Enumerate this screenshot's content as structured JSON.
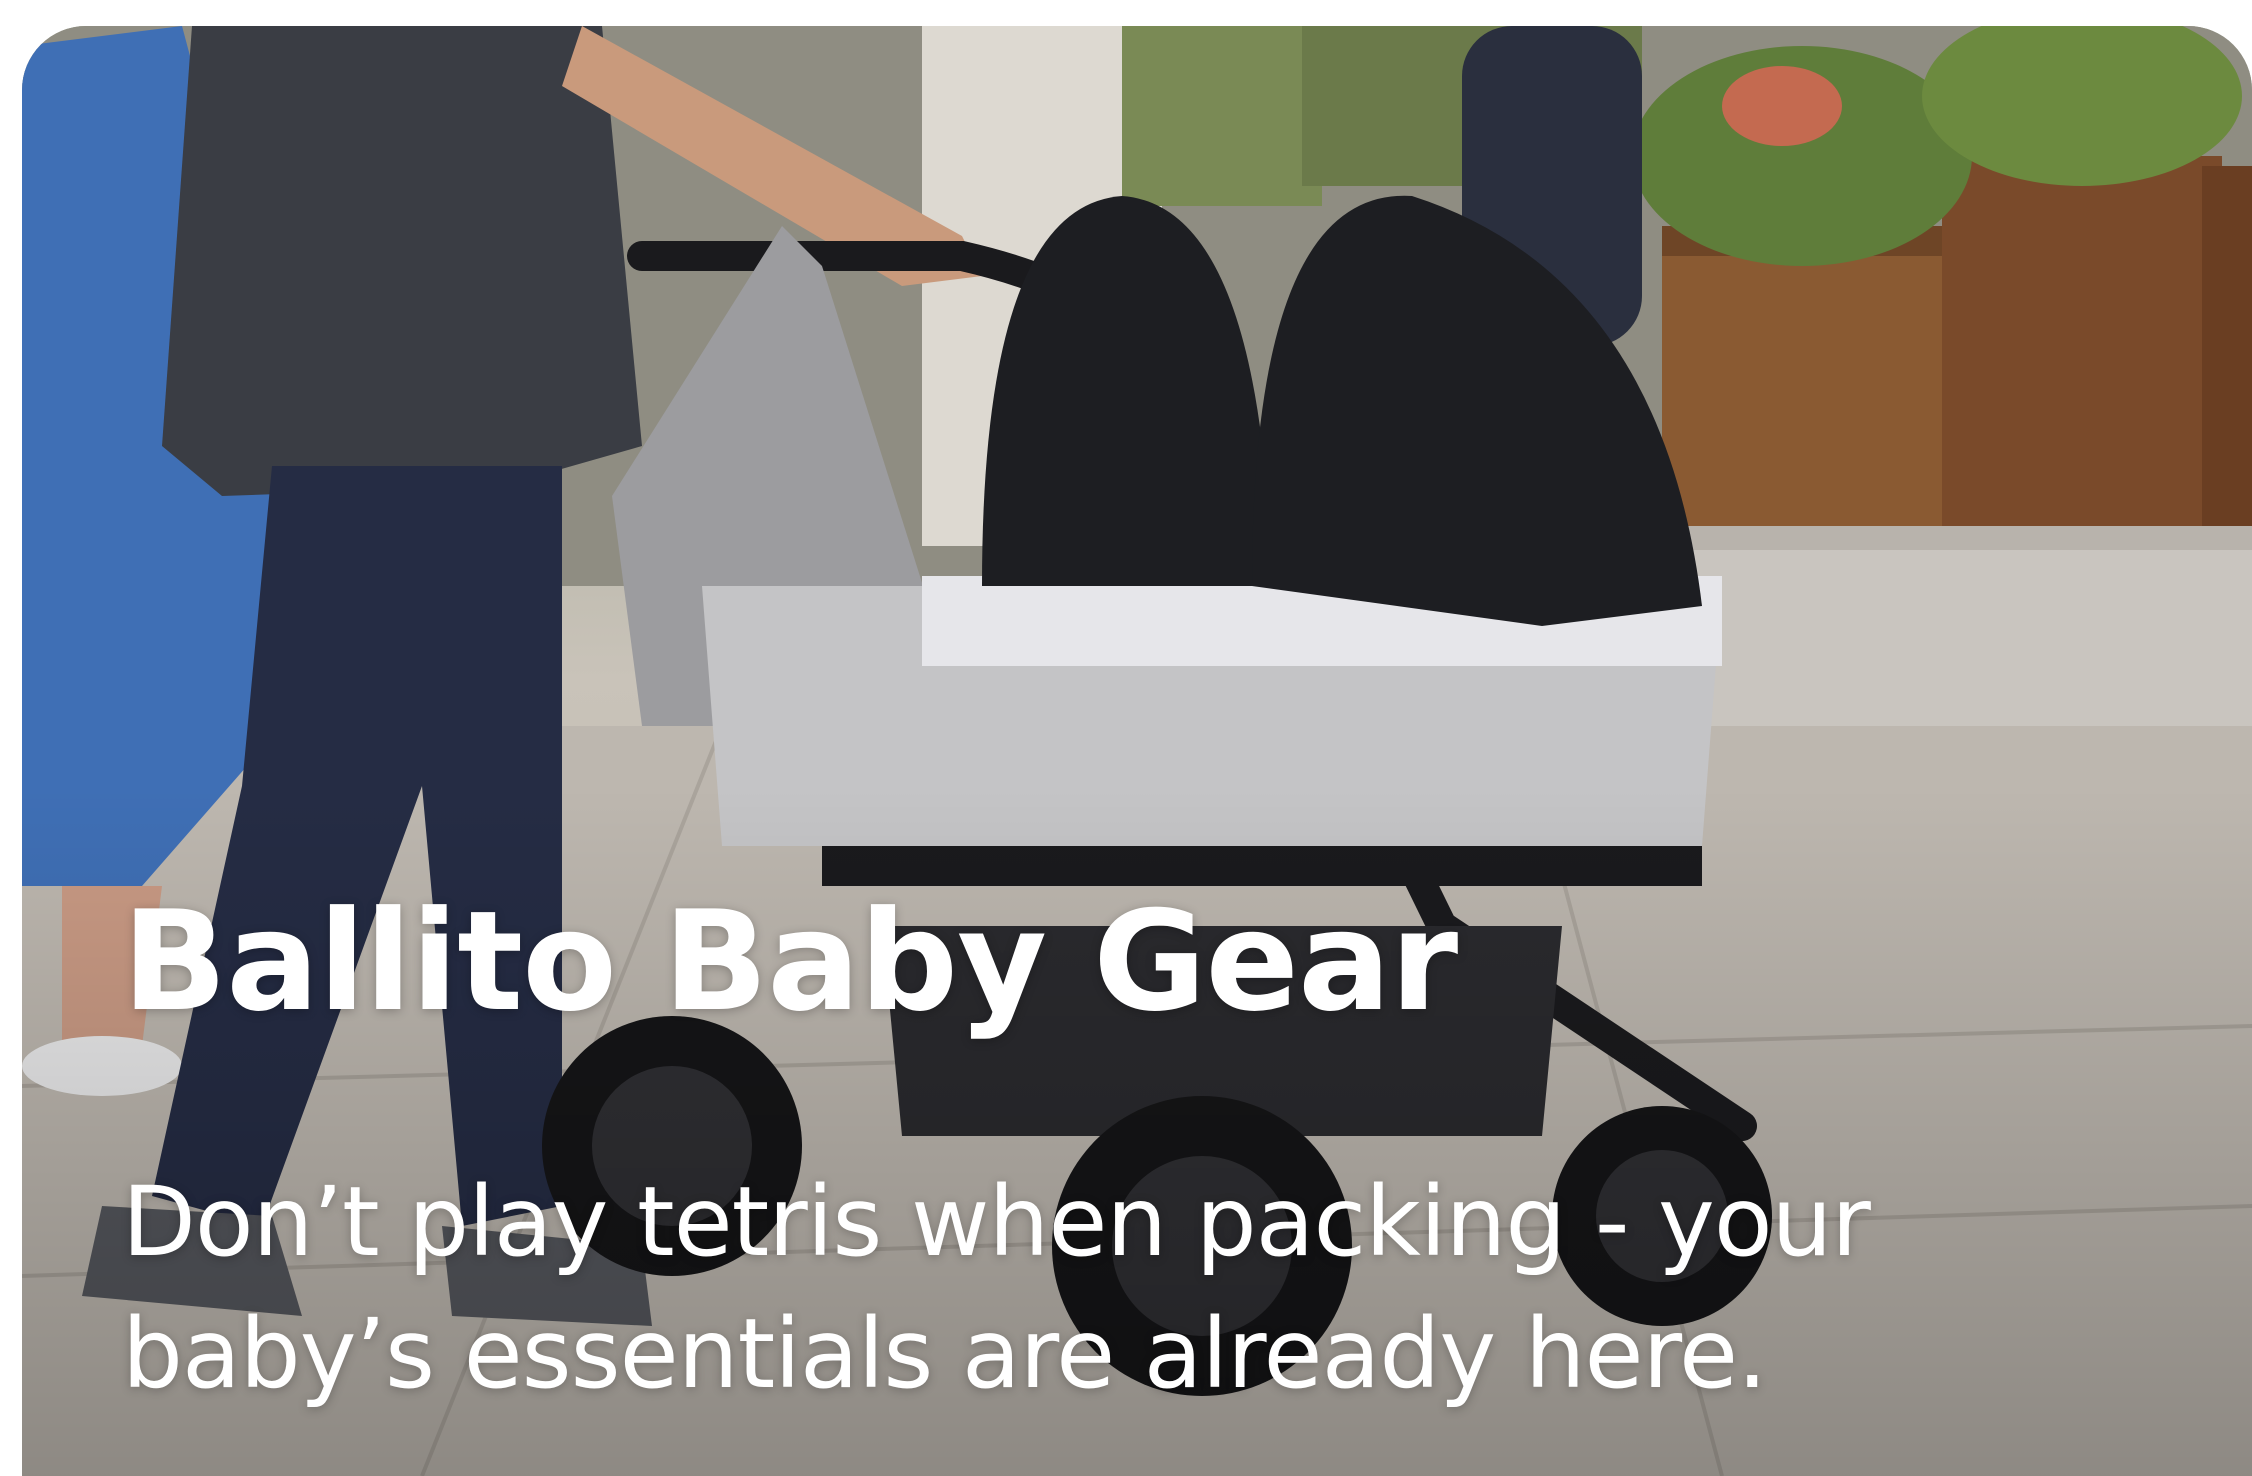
{
  "card": {
    "title": "Ballito Baby Gear",
    "description": "Don’t play tetris when packing - your baby’s essentials are already here.",
    "image_subject": "person pushing a twin stroller on a paved street"
  },
  "colors": {
    "text": "#ffffff",
    "stroller_fabric": "#c4c4c6",
    "stroller_hood": "#1d1e22",
    "pavement": "#b9b3ab"
  }
}
